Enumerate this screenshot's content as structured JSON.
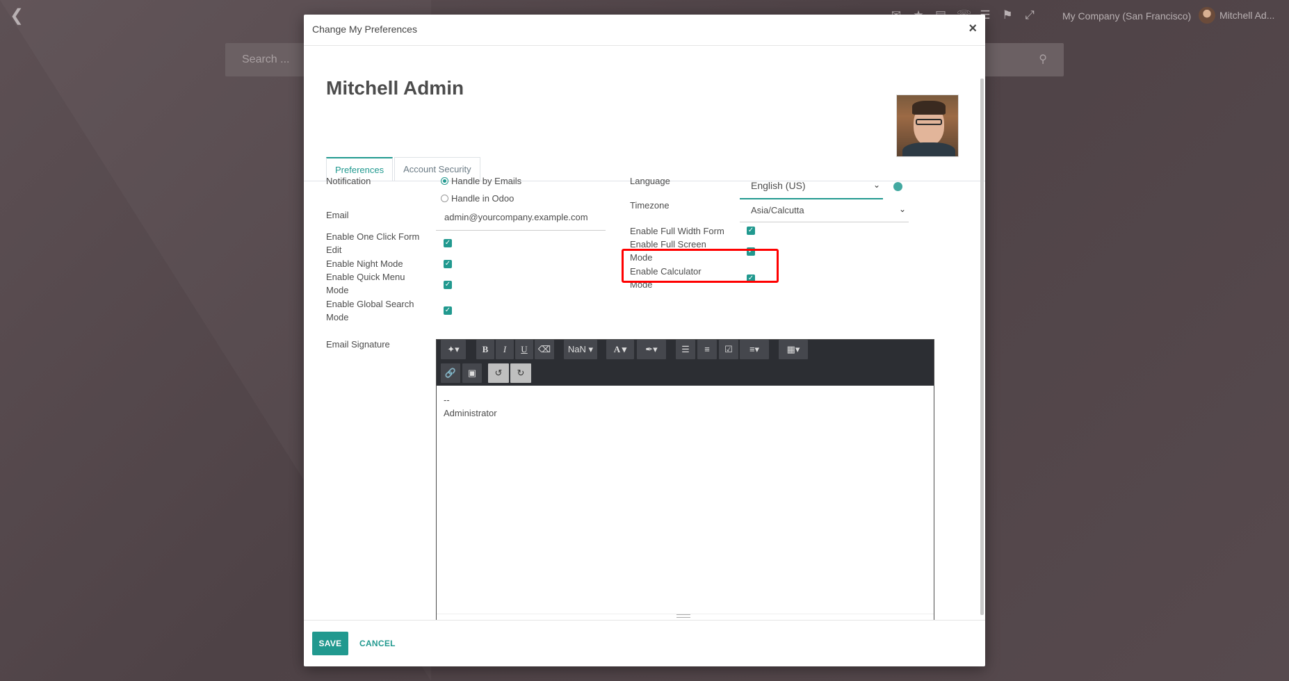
{
  "topbar": {
    "company": "My Company (San Francisco)",
    "user_name": "Mitchell Ad...",
    "icons": [
      "back-icon",
      "chat-icon",
      "activity-icon",
      "mail-icon",
      "phone-icon",
      "menu-icon",
      "bookmark-icon",
      "fullscreen-icon"
    ]
  },
  "search": {
    "placeholder": "Search ..."
  },
  "modal": {
    "title": "Change My Preferences",
    "close_symbol": "×",
    "user_name": "Mitchell Admin",
    "tabs": [
      {
        "label": "Preferences",
        "active": true
      },
      {
        "label": "Account Security",
        "active": false
      }
    ],
    "left_fields": {
      "notification_label": "Notification",
      "notification_options": [
        {
          "label": "Handle by Emails",
          "selected": true
        },
        {
          "label": "Handle in Odoo",
          "selected": false
        }
      ],
      "email_label": "Email",
      "email_value": "admin@yourcompany.example.com",
      "one_click_label": "Enable One Click Form Edit",
      "night_mode_label": "Enable Night Mode",
      "quick_menu_label": "Enable Quick Menu Mode",
      "global_search_label": "Enable Global Search Mode",
      "email_signature_label": "Email Signature"
    },
    "right_fields": {
      "language_label": "Language",
      "language_value": "English (US)",
      "timezone_label": "Timezone",
      "timezone_value": "Asia/Calcutta",
      "full_width_label": "Enable Full Width Form",
      "full_screen_label": "Enable Full Screen Mode",
      "calculator_label": "Enable Calculator Mode"
    },
    "editor": {
      "font_size_label": "NaN",
      "content_line1": "--",
      "content_line2": "Administrator"
    },
    "footer": {
      "save_label": "SAVE",
      "cancel_label": "CANCEL"
    }
  },
  "colors": {
    "accent": "#21998f",
    "highlight": "#ff0000",
    "toolbar": "#2c2e33"
  }
}
